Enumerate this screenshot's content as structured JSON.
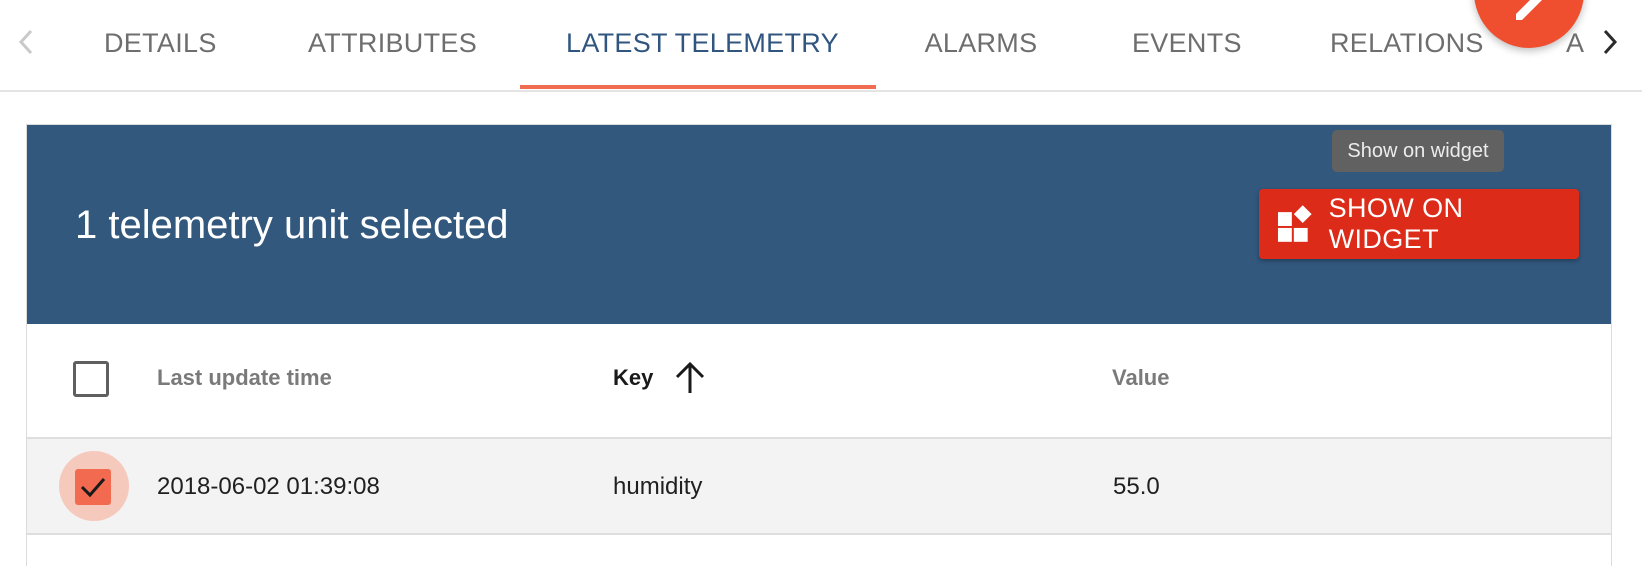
{
  "tabs": [
    {
      "label": "DETAILS",
      "active": false
    },
    {
      "label": "ATTRIBUTES",
      "active": false
    },
    {
      "label": "LATEST TELEMETRY",
      "active": true
    },
    {
      "label": "ALARMS",
      "active": false
    },
    {
      "label": "EVENTS",
      "active": false
    },
    {
      "label": "RELATIONS",
      "active": false
    }
  ],
  "tab_overflow_fragment": "A",
  "header": {
    "selected_text": "1 telemetry unit selected",
    "tooltip": "Show on widget",
    "show_widget_button": "SHOW ON WIDGET"
  },
  "table": {
    "columns": {
      "last_update": "Last update time",
      "key": "Key",
      "value": "Value"
    },
    "sort": {
      "column": "key",
      "direction": "ascending"
    },
    "rows": [
      {
        "last_update": "2018-06-02 01:39:08",
        "key": "humidity",
        "value": "55.0",
        "selected": true
      }
    ]
  },
  "colors": {
    "accent": "#ef6c50",
    "header_bg": "#32587e",
    "button_bg": "#dd2b19",
    "fab_bg": "#ef4f2e"
  }
}
